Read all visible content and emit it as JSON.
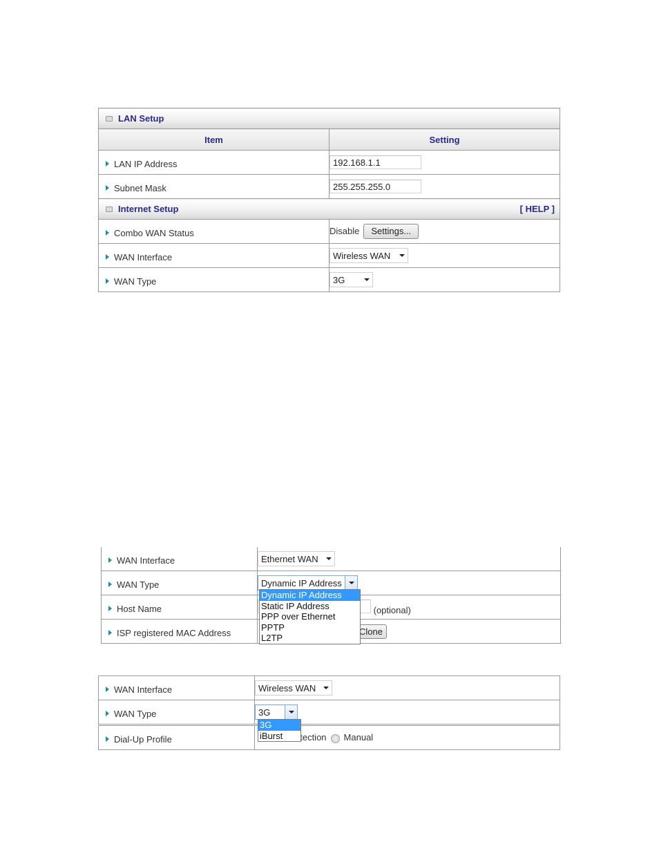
{
  "panel1": {
    "lan_section_title": "LAN Setup",
    "column_item": "Item",
    "column_setting": "Setting",
    "lan_ip_label": "LAN IP Address",
    "lan_ip_value": "192.168.1.1",
    "subnet_label": "Subnet Mask",
    "subnet_value": "255.255.255.0",
    "internet_section_title": "Internet Setup",
    "help_link": "[ HELP ]",
    "combo_label": "Combo WAN Status",
    "combo_status": "Disable",
    "settings_button": "Settings...",
    "wan_interface_label": "WAN Interface",
    "wan_interface_value": "Wireless WAN",
    "wan_type_label": "WAN Type",
    "wan_type_value": "3G"
  },
  "panel2": {
    "wan_interface_label": "WAN Interface",
    "wan_interface_value": "Ethernet WAN",
    "wan_type_label": "WAN Type",
    "wan_type_value": "Dynamic IP Address",
    "host_name_label": "Host Name",
    "host_name_hint": "(optional)",
    "mac_label": "ISP registered MAC Address",
    "clone_button": "Clone",
    "wan_type_options": [
      "Dynamic IP Address",
      "Static IP Address",
      "PPP over Ethernet",
      "PPTP",
      "L2TP"
    ],
    "selected_option": "Dynamic IP Address"
  },
  "panel3": {
    "wan_interface_label": "WAN Interface",
    "wan_interface_value": "Wireless WAN",
    "wan_type_label": "WAN Type",
    "wan_type_value": "3G",
    "dialup_label": "Dial-Up Profile",
    "dialup_partial_text": "etection",
    "manual_label": "Manual",
    "wan_type_options": [
      "3G",
      "iBurst"
    ],
    "selected_option": "3G"
  }
}
